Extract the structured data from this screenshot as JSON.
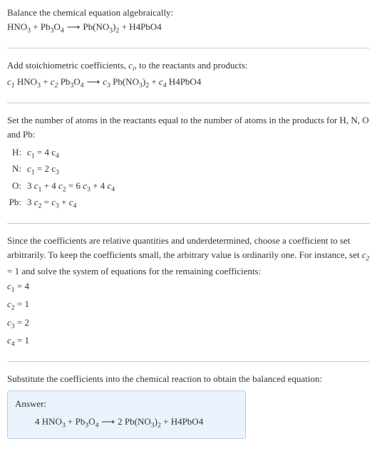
{
  "sections": {
    "balance": {
      "intro": "Balance the chemical equation algebraically:"
    },
    "stoich": {
      "intro": "Add stoichiometric coefficients, ",
      "intro2": ", to the reactants and products:"
    },
    "atoms": {
      "intro": "Set the number of atoms in the reactants equal to the number of atoms in the products for H, N, O and Pb:",
      "rows": [
        {
          "label": "H:",
          "eq_pre": "c",
          "eq": " = 4 c",
          "sub1": "1",
          "sub2": "4"
        },
        {
          "label": "N:",
          "eq_pre": "c",
          "eq": " = 2 c",
          "sub1": "1",
          "sub2": "3"
        }
      ],
      "o_label": "O:",
      "pb_label": "Pb:"
    },
    "coeffs": {
      "intro": "Since the coefficients are relative quantities and underdetermined, choose a coefficient to set arbitrarily. To keep the coefficients small, the arbitrary value is ordinarily one. For instance, set ",
      "intro2": " = 1 and solve the system of equations for the remaining coefficients:",
      "lines": [
        {
          "sub": "1",
          "val": " = 4"
        },
        {
          "sub": "2",
          "val": " = 1"
        },
        {
          "sub": "3",
          "val": " = 2"
        },
        {
          "sub": "4",
          "val": " = 1"
        }
      ]
    },
    "substitute": {
      "intro": "Substitute the coefficients into the chemical reaction to obtain the balanced equation:"
    },
    "answer": {
      "title": "Answer:"
    }
  },
  "chem": {
    "hno3_h": "HNO",
    "hno3_sub": "3",
    "plus": " + ",
    "pb3o4_pb": "Pb",
    "pb3o4_sub1": "3",
    "pb3o4_o": "O",
    "pb3o4_sub2": "4",
    "arrow": "⟶",
    "pbno3_pb": "Pb(NO",
    "pbno3_sub1": "3",
    "pbno3_close": ")",
    "pbno3_sub2": "2",
    "h4pbo4": "H4PbO4",
    "c": "c",
    "ci_sub": "i",
    "c1": "1",
    "c2": "2",
    "c3": "3",
    "c4": "4",
    "three": "3 ",
    "four": "4 ",
    "six": "6 ",
    "two": "2 ",
    "plus4": " + 4 ",
    "eq": " = ",
    "plus2": " + "
  }
}
